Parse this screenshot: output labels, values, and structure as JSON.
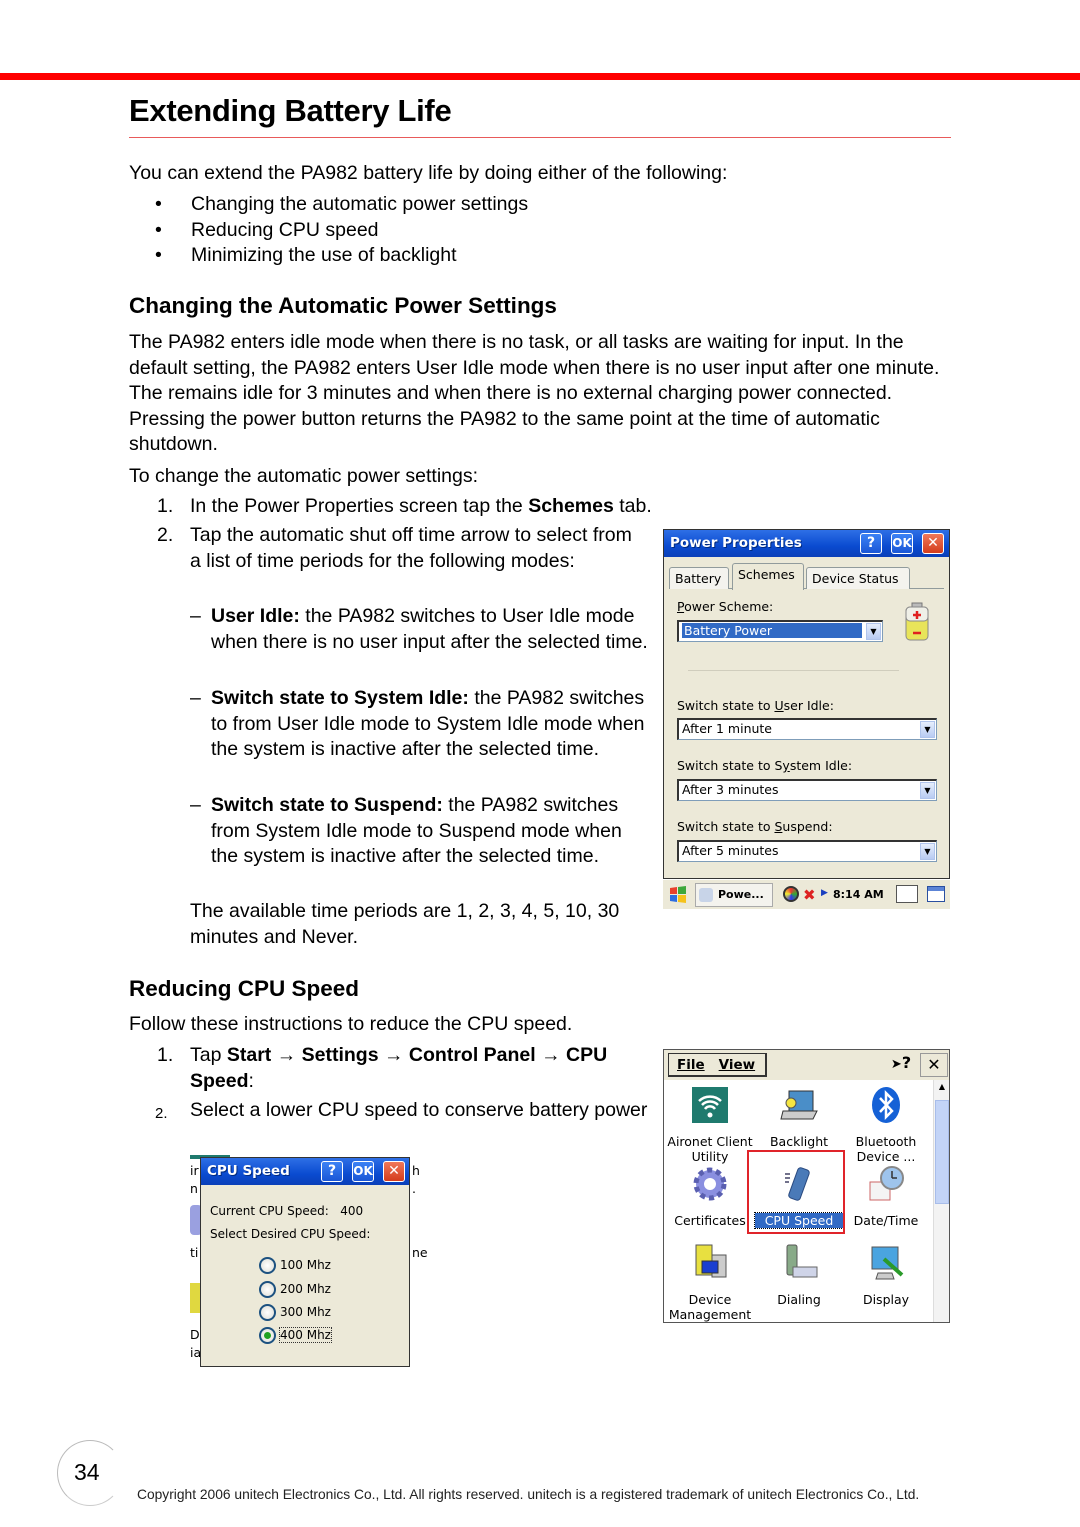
{
  "page": {
    "title": "Extending Battery Life",
    "accent_color": "#ff0000",
    "page_number": "34",
    "copyright": "Copyright 2006 unitech Electronics Co., Ltd. All rights reserved. unitech is a registered trademark of unitech Electronics Co., Ltd."
  },
  "intro": {
    "text": "You can extend the PA982 battery life by doing either of the following:",
    "bullets": [
      "Changing the automatic power settings",
      "Reducing CPU speed",
      "Minimizing the use of backlight"
    ],
    "bullet_glyph": "•"
  },
  "section_power": {
    "heading": "Changing the Automatic Power Settings",
    "para1": "The PA982 enters idle mode when there is no task, or all tasks are waiting for input. In the default setting, the PA982 enters User Idle mode when there is no user input after one minute. The remains idle for 3 minutes and when there is no external charging power connected. Pressing the power button returns the PA982 to the same point at the time of automatic shutdown.",
    "para2": "To change the automatic power settings:",
    "steps": [
      {
        "num": "1.",
        "pre": "In the Power Properties screen tap the ",
        "bold": "Schemes",
        "post": " tab."
      },
      {
        "num": "2.",
        "text": "Tap the automatic shut off time arrow to select from a list of time periods for the following modes:"
      }
    ],
    "sub_items": [
      {
        "dash": "–",
        "bold": "User Idle:",
        "text": " the PA982 switches to User Idle mode when there is no user input after the selected time."
      },
      {
        "dash": "–",
        "bold": "Switch state to System Idle:",
        "text": " the PA982 switches to from User Idle mode to System Idle mode when the system is inactive after the selected time."
      },
      {
        "dash": "–",
        "bold": "Switch state to Suspend:",
        "text": " the PA982 switches from System Idle mode to Suspend mode when the system is inactive after the selected time."
      }
    ],
    "available": "The available time periods are 1, 2, 3, 4, 5, 10, 30 minutes and Never."
  },
  "power_dialog": {
    "title": "Power Properties",
    "help_btn": "?",
    "ok_btn": "OK",
    "close_btn": "✕",
    "tabs": [
      "Battery",
      "Schemes",
      "Device Status"
    ],
    "active_tab": "Schemes",
    "scheme_label_u": "P",
    "scheme_label_rest": "ower Scheme:",
    "scheme_value": "Battery Power",
    "user_idle_pre": "Switch state to ",
    "user_idle_u": "U",
    "user_idle_post": "ser Idle:",
    "user_idle_value": "After 1 minute",
    "system_idle_pre": "Switch state to S",
    "system_idle_u": "y",
    "system_idle_post": "stem Idle:",
    "system_idle_value": "After 3 minutes",
    "suspend_pre": "Switch state to ",
    "suspend_u": "S",
    "suspend_post": "uspend:",
    "suspend_value": "After 5 minutes",
    "dropdown_arrow": "▼"
  },
  "taskbar": {
    "task_label": "Powe...",
    "clock": "8:14 AM"
  },
  "section_cpu": {
    "heading": "Reducing CPU Speed",
    "intro": "Follow these instructions to reduce the CPU speed.",
    "step1_num": "1.",
    "step1_pre": "Tap ",
    "step1_path": [
      "Start",
      "Settings",
      "Control Panel",
      "CPU Speed"
    ],
    "arrow": "→",
    "step1_post": ":",
    "step2_num": "2.",
    "step2_text": "Select a lower CPU speed to conserve battery power"
  },
  "control_panel": {
    "menu_file": "File",
    "menu_view": "View",
    "help": "?",
    "close": "✕",
    "scroll_up": "▲",
    "items": [
      {
        "label": "Aironet Client Utility",
        "icon": "wifi-icon"
      },
      {
        "label": "Backlight",
        "icon": "laptop-bulb-icon"
      },
      {
        "label": "Bluetooth Device ...",
        "icon": "bluetooth-icon"
      },
      {
        "label": "Certificates",
        "icon": "gear-icon"
      },
      {
        "label": "CPU Speed",
        "icon": "cpu-chip-icon",
        "selected": true
      },
      {
        "label": "Date/Time",
        "icon": "clock-calendar-icon"
      },
      {
        "label": "Device Management",
        "icon": "building-computer-icon"
      },
      {
        "label": "Dialing",
        "icon": "phone-modem-icon"
      },
      {
        "label": "Display",
        "icon": "monitor-brush-icon"
      }
    ]
  },
  "cpu_dialog": {
    "title": "CPU Speed",
    "help_btn": "?",
    "ok_btn": "OK",
    "close_btn": "✕",
    "current_label": "Current CPU Speed:",
    "current_value": "400",
    "select_label": "Select Desired CPU Speed:",
    "options": [
      "100 Mhz",
      "200 Mhz",
      "300 Mhz",
      "400 Mhz"
    ],
    "selected": "400 Mhz",
    "bg_fragments": [
      "ir",
      "n",
      "ti",
      "De",
      "ia",
      "h",
      ".",
      "ne"
    ]
  }
}
